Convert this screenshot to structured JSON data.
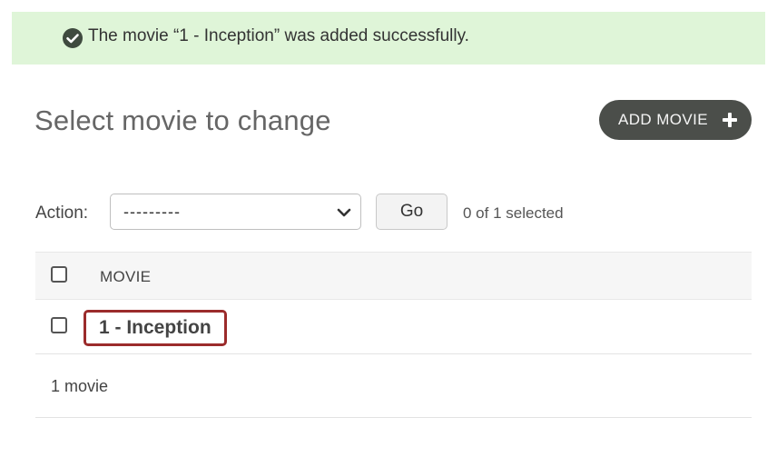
{
  "message": {
    "text": "The movie “1 - Inception” was added successfully.",
    "icon": "check-circle-icon",
    "background": "#dff5d8"
  },
  "header": {
    "title": "Select movie to change",
    "add_button_label": "ADD MOVIE",
    "add_button_icon": "plus-icon"
  },
  "actions": {
    "label": "Action:",
    "selected_value": "---------",
    "go_label": "Go",
    "selected_count": "0 of 1 selected"
  },
  "table": {
    "column_header": "MOVIE",
    "rows": [
      {
        "title": "1 - Inception"
      }
    ]
  },
  "paginator": {
    "text": "1 movie"
  },
  "colors": {
    "add_button_bg": "#4b4e4a",
    "highlight_border": "#9b2b2b"
  }
}
